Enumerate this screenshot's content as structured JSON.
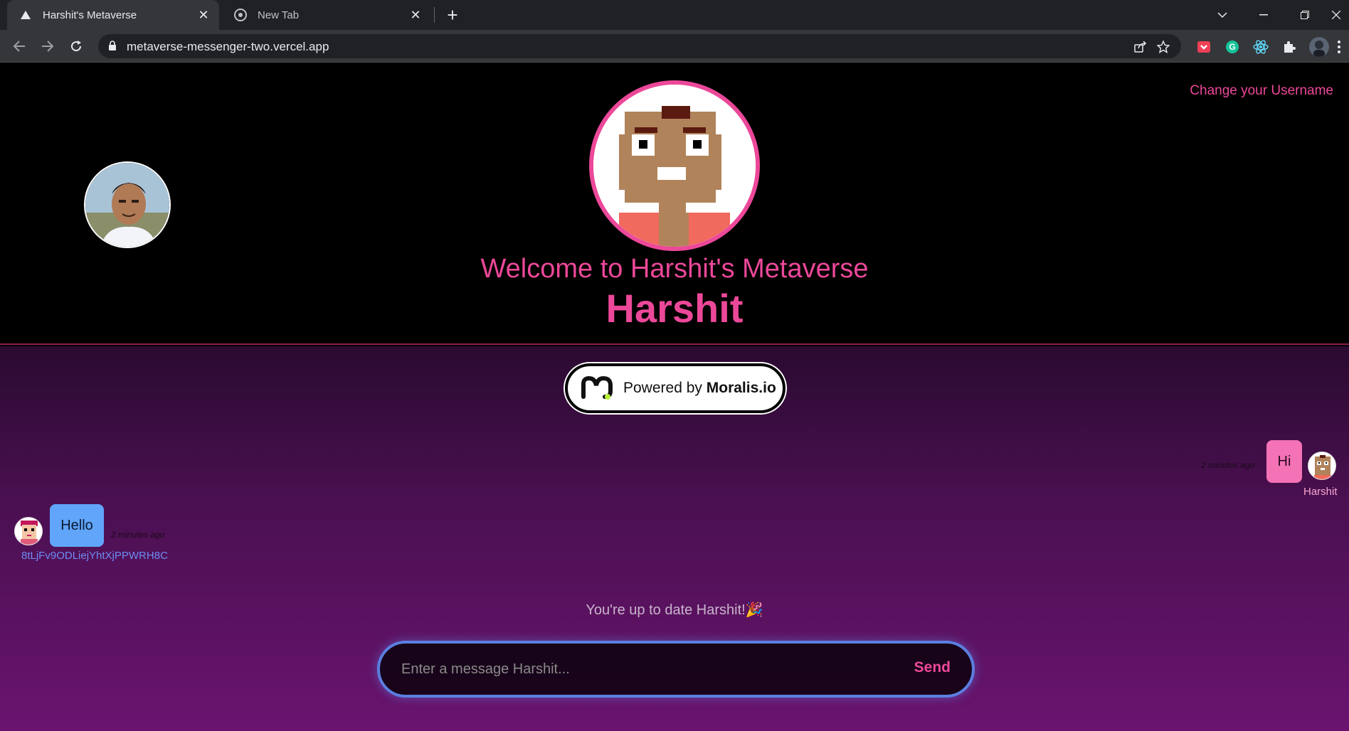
{
  "browser": {
    "tabs": [
      {
        "title": "Harshit's Metaverse",
        "active": true
      },
      {
        "title": "New Tab",
        "active": false
      }
    ],
    "url": "metaverse-messenger-two.vercel.app"
  },
  "header": {
    "change_username": "Change your Username",
    "welcome": "Welcome to Harshit's Metaverse",
    "username": "Harshit"
  },
  "powered": {
    "prefix": "Powered by",
    "brand": "Moralis.io"
  },
  "messages": [
    {
      "text": "Hi",
      "time": "2 minutes ago",
      "user": "Harshit",
      "side": "right",
      "color": "#f472b6"
    },
    {
      "text": "Hello",
      "time": "2 minutes ago",
      "user": "8tLjFv9ODLiejYhtXjPPWRH8C",
      "side": "left",
      "color": "#60a5fa"
    }
  ],
  "status": {
    "up_to_date": "You're up to date Harshit!",
    "emoji": "🎉"
  },
  "composer": {
    "placeholder": "Enter a message Harshit...",
    "send_label": "Send"
  },
  "colors": {
    "accent": "#ec4899",
    "input_border": "#5b7fe0"
  }
}
